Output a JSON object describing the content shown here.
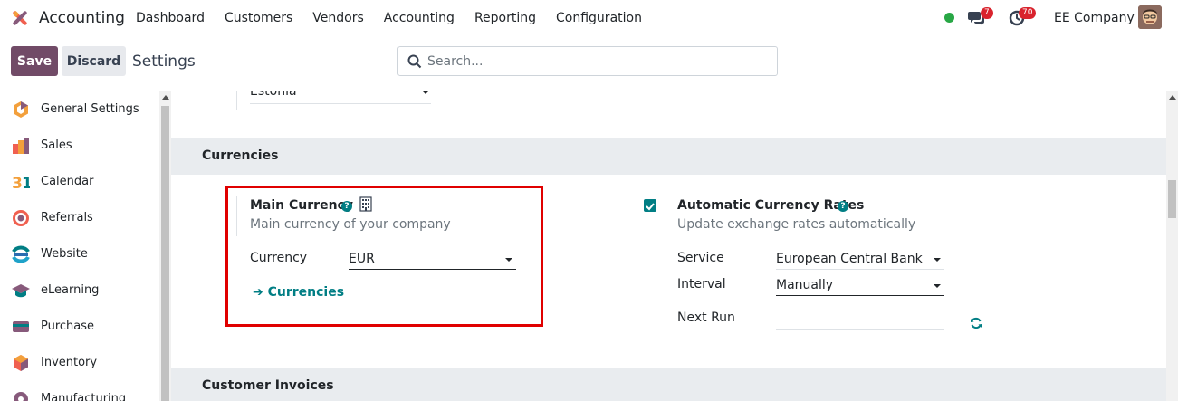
{
  "navbar": {
    "app_name": "Accounting",
    "menu": [
      "Dashboard",
      "Customers",
      "Vendors",
      "Accounting",
      "Reporting",
      "Configuration"
    ],
    "chat_count": "7",
    "activity_count": "70",
    "company": "EE Company",
    "status_color": "#28a745"
  },
  "control": {
    "save_label": "Save",
    "discard_label": "Discard",
    "breadcrumb": "Settings",
    "search_placeholder": "Search..."
  },
  "sidebar": {
    "items": [
      {
        "label": "General Settings",
        "icon": "general-settings-icon"
      },
      {
        "label": "Sales",
        "icon": "sales-icon"
      },
      {
        "label": "Calendar",
        "icon": "calendar-icon"
      },
      {
        "label": "Referrals",
        "icon": "referrals-icon"
      },
      {
        "label": "Website",
        "icon": "website-icon"
      },
      {
        "label": "eLearning",
        "icon": "elearning-icon"
      },
      {
        "label": "Purchase",
        "icon": "purchase-icon"
      },
      {
        "label": "Inventory",
        "icon": "inventory-icon"
      },
      {
        "label": "Manufacturing",
        "icon": "manufacturing-icon"
      }
    ]
  },
  "main": {
    "country_value": "Estonia",
    "currencies_header": "Currencies",
    "main_currency": {
      "title": "Main Currency",
      "description": "Main currency of your company",
      "currency_label": "Currency",
      "currency_value": "EUR",
      "link_label": "Currencies"
    },
    "auto_rates": {
      "title": "Automatic Currency Rates",
      "description": "Update exchange rates automatically",
      "checked": true,
      "service_label": "Service",
      "service_value": "European Central Bank",
      "interval_label": "Interval",
      "interval_value": "Manually",
      "next_run_label": "Next Run",
      "next_run_value": ""
    },
    "customer_invoices_header": "Customer Invoices"
  },
  "colors": {
    "brand": "#714b67",
    "accent": "#017e84",
    "highlight": "#e00000",
    "badge": "#d9232d"
  }
}
